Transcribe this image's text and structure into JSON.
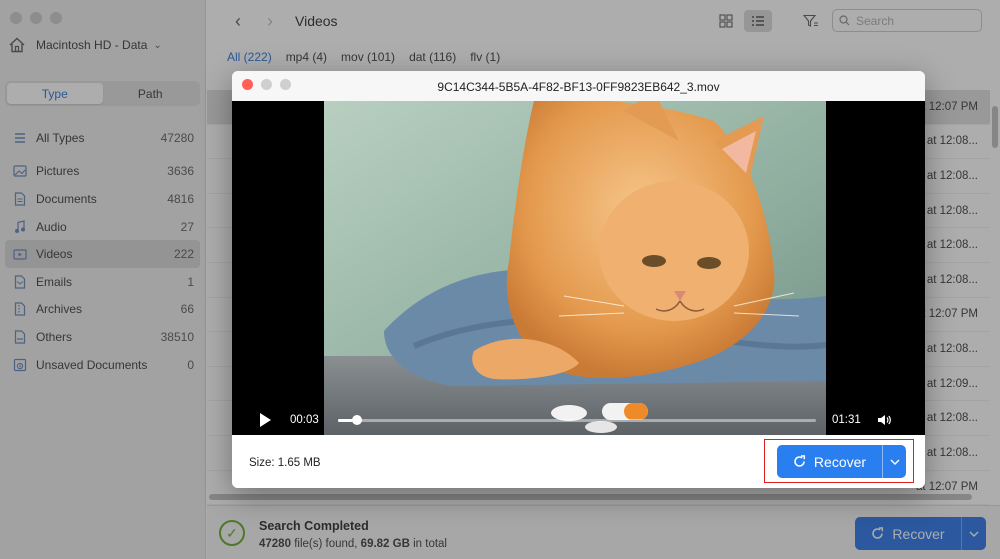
{
  "sidebar": {
    "drive_label": "Macintosh HD - Data",
    "tabs": [
      {
        "label": "Type",
        "active": true
      },
      {
        "label": "Path",
        "active": false
      }
    ],
    "categories": [
      {
        "label": "All Types",
        "count": "47280",
        "icon": "all-types-icon"
      },
      {
        "label": "Pictures",
        "count": "3636",
        "icon": "picture-icon"
      },
      {
        "label": "Documents",
        "count": "4816",
        "icon": "document-icon"
      },
      {
        "label": "Audio",
        "count": "27",
        "icon": "audio-icon"
      },
      {
        "label": "Videos",
        "count": "222",
        "icon": "video-icon",
        "selected": true
      },
      {
        "label": "Emails",
        "count": "1",
        "icon": "email-icon"
      },
      {
        "label": "Archives",
        "count": "66",
        "icon": "archive-icon"
      },
      {
        "label": "Others",
        "count": "38510",
        "icon": "others-icon"
      },
      {
        "label": "Unsaved Documents",
        "count": "0",
        "icon": "unsaved-document-icon"
      }
    ]
  },
  "toolbar": {
    "title": "Videos",
    "search_placeholder": "Search"
  },
  "filter_tabs": [
    "All (222)",
    "mp4 (4)",
    "mov (101)",
    "dat (116)",
    "flv (1)"
  ],
  "file_rows": [
    "at 12:07 PM",
    "at 12:08...",
    "at 12:08...",
    "at 12:08...",
    "at 12:08...",
    "at 12:08...",
    "at 12:07 PM",
    "at 12:08...",
    "at 12:09...",
    "at 12:08...",
    "at 12:08...",
    "at 12:07 PM"
  ],
  "status": {
    "title": "Search Completed",
    "files_found": "47280",
    "files_found_suffix": "file(s) found,",
    "total_size": "69.82 GB",
    "total_suffix": "in total",
    "recover_label": "Recover"
  },
  "preview": {
    "title": "9C14C344-5B5A-4F82-BF13-0FF9823EB642_3.mov",
    "current_time": "00:03",
    "duration": "01:31",
    "progress": 0.04,
    "size_text": "Size: 1.65 MB",
    "recover_label": "Recover"
  },
  "colors": {
    "accent": "#1f6de6",
    "highlight_frame": "#e02020",
    "success": "#5ca51f"
  }
}
